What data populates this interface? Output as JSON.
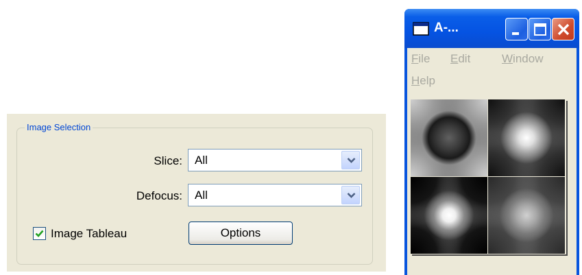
{
  "image_selection": {
    "group_title": "Image Selection",
    "slice_label": "Slice:",
    "slice_value": "All",
    "defocus_label": "Defocus:",
    "defocus_value": "All",
    "tableau_label": "Image Tableau",
    "tableau_checked": true,
    "options_label": "Options"
  },
  "window": {
    "title": "A-...",
    "menu": [
      "File",
      "Edit",
      "Window",
      "Help"
    ]
  },
  "colors": {
    "panel_bg": "#ece9d8",
    "group_title": "#0046d5",
    "titlebar": "#0553e2",
    "close_button": "#cf4b2c",
    "menu_disabled": "#a9a9a0"
  },
  "icons": [
    "dropdown-arrow-icon",
    "checkmark-icon",
    "window-app-icon",
    "minimize-icon",
    "maximize-icon",
    "close-icon"
  ]
}
